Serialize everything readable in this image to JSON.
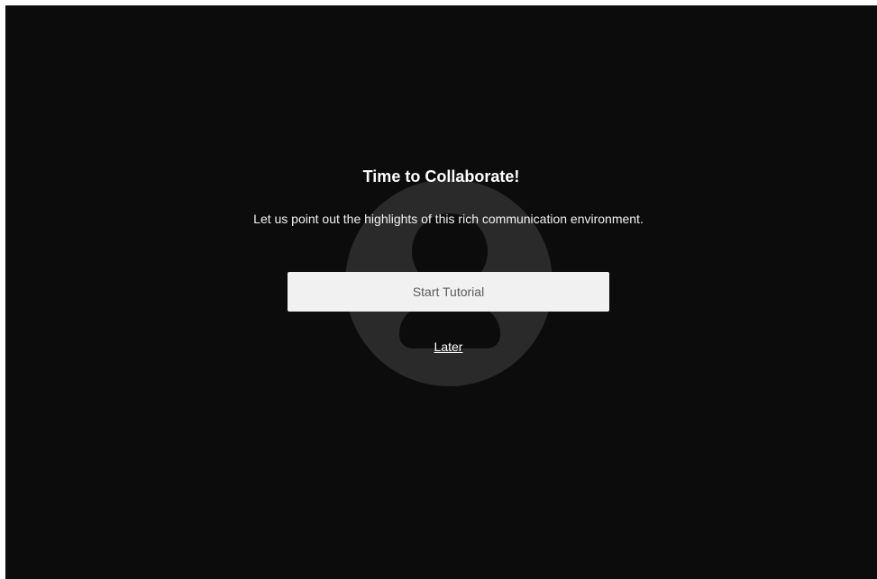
{
  "dialog": {
    "title": "Time to Collaborate!",
    "subtitle": "Let us point out the highlights of this rich communication environment.",
    "start_button_label": "Start Tutorial",
    "later_link_label": "Later"
  },
  "icons": {
    "background_icon": "user-silhouette-icon"
  },
  "colors": {
    "overlay": "#0c0c0c",
    "avatar_circle": "#2a2a2a",
    "button_background": "#f1f1f1",
    "button_text": "#5a5a5a",
    "text": "#ffffff"
  }
}
